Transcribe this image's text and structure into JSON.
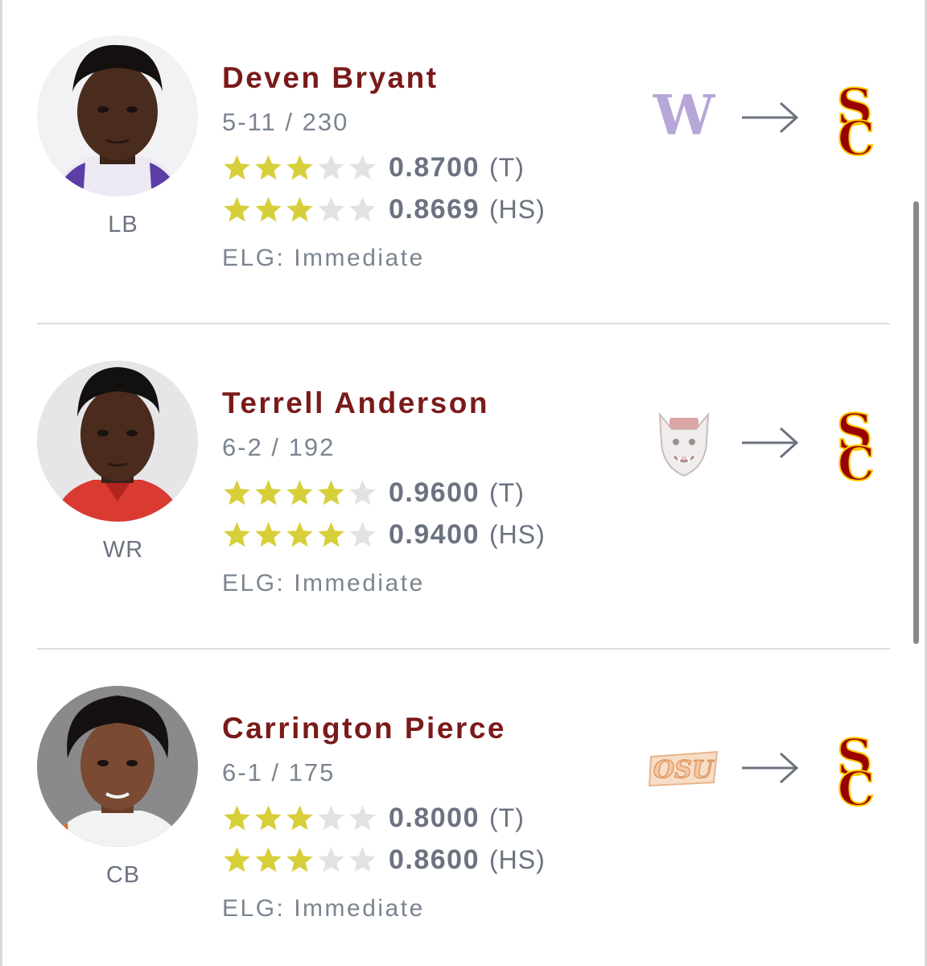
{
  "transfers": [
    {
      "name": "Deven Bryant",
      "measurements": "5-11 / 230",
      "position": "LB",
      "ratings": [
        {
          "stars": 3,
          "max_stars": 5,
          "value": "0.8700",
          "type": "(T)"
        },
        {
          "stars": 3,
          "max_stars": 5,
          "value": "0.8669",
          "type": "(HS)"
        }
      ],
      "eligibility": "ELG: Immediate",
      "from_school_icon": "washington-w-logo",
      "to_school_icon": "usc-sc-logo"
    },
    {
      "name": "Terrell Anderson",
      "measurements": "6-2 / 192",
      "position": "WR",
      "ratings": [
        {
          "stars": 4,
          "max_stars": 5,
          "value": "0.9600",
          "type": "(T)"
        },
        {
          "stars": 4,
          "max_stars": 5,
          "value": "0.9400",
          "type": "(HS)"
        }
      ],
      "eligibility": "ELG: Immediate",
      "from_school_icon": "nc-state-wolf-logo",
      "to_school_icon": "usc-sc-logo"
    },
    {
      "name": "Carrington Pierce",
      "measurements": "6-1 / 175",
      "position": "CB",
      "ratings": [
        {
          "stars": 3,
          "max_stars": 5,
          "value": "0.8000",
          "type": "(T)"
        },
        {
          "stars": 3,
          "max_stars": 5,
          "value": "0.8600",
          "type": "(HS)"
        }
      ],
      "eligibility": "ELG: Immediate",
      "from_school_icon": "oklahoma-state-osu-logo",
      "to_school_icon": "usc-sc-logo"
    }
  ],
  "logos": {
    "washington_letter": "W",
    "osu_text": "OSU",
    "usc_text": "SC"
  },
  "colors": {
    "name": "#7a1a1a",
    "star_filled": "#d6cf3a",
    "star_empty": "#e2e2e2",
    "usc_cardinal": "#990000",
    "usc_gold": "#ffcc00",
    "washington_purple": "#b7a6d8"
  }
}
